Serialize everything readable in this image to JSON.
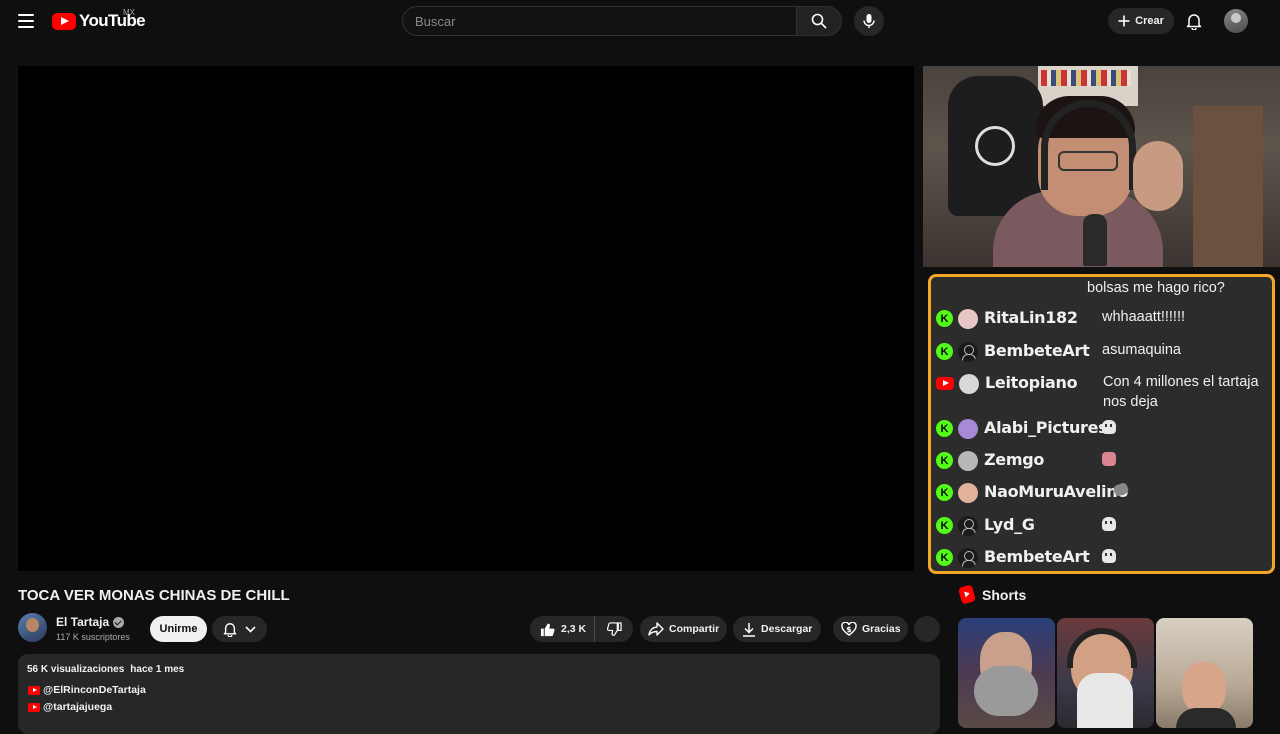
{
  "header": {
    "logo_text": "YouTube",
    "country": "MX",
    "search_placeholder": "Buscar",
    "create_label": "Crear"
  },
  "video": {
    "title": "TOCA VER MONAS CHINAS DE CHILL",
    "channel_name": "El Tartaja",
    "subscribers": "117 K suscriptores",
    "join_label": "Unirme",
    "likes": "2,3 K",
    "share_label": "Compartir",
    "download_label": "Descargar",
    "thanks_label": "Gracias"
  },
  "description": {
    "views": "56 K visualizaciones",
    "date": "hace 1 mes",
    "links": [
      "@ElRinconDeTartaja",
      "@tartajajuega"
    ]
  },
  "chat": {
    "partial_message": "bolsas me hago rico?",
    "messages": [
      {
        "platform": "kick",
        "user": "RitaLin182",
        "text": "whhaaatt!!!!!!"
      },
      {
        "platform": "kick",
        "user": "BembeteArt",
        "text": "asumaquina"
      },
      {
        "platform": "youtube",
        "user": "Leitopiano",
        "text": "Con 4 millones el tartaja nos deja"
      },
      {
        "platform": "kick",
        "user": "Alabi_Pictures",
        "emote": "skull-emote"
      },
      {
        "platform": "kick",
        "user": "Zemgo",
        "emote": "pink-emote"
      },
      {
        "platform": "kick",
        "user": "NaoMuruAvelino",
        "emote": "grey-emote"
      },
      {
        "platform": "kick",
        "user": "Lyd_G",
        "emote": "skull-emote"
      },
      {
        "platform": "kick",
        "user": "BembeteArt",
        "emote": "skull-emote"
      }
    ],
    "kick_badge": "K",
    "border_color": "#f5a623",
    "kick_color": "#53fc18"
  },
  "shorts": {
    "title": "Shorts"
  },
  "colors": {
    "background": "#0f0f0f",
    "brand_red": "#ff0000"
  }
}
